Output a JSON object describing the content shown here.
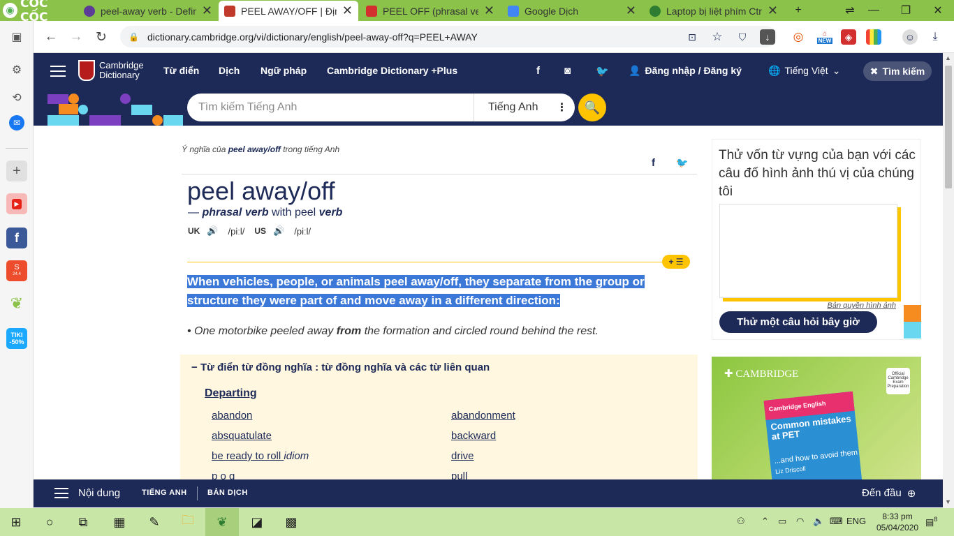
{
  "browser": {
    "brand": "CỐC CỐC",
    "tabs": [
      {
        "title": "peel-away verb - Definit",
        "active": false
      },
      {
        "title": "PEEL AWAY/OFF | Định n",
        "active": true
      },
      {
        "title": "PEEL OFF (phrasal verb)",
        "active": false
      },
      {
        "title": "Google Dịch",
        "active": false
      },
      {
        "title": "Laptop bị liệt phím Ctrl",
        "active": false
      }
    ],
    "new_tab": "+",
    "url": "dictionary.cambridge.org/vi/dictionary/english/peel-away-off?q=PEEL+AWAY",
    "new_badge": "NEW"
  },
  "sidebar_apps": {
    "tiki_label": "TIKI -50%",
    "shopee_label": "24.4"
  },
  "header": {
    "logo_line1": "Cambridge",
    "logo_line2": "Dictionary",
    "nav": [
      "Từ điển",
      "Dịch",
      "Ngữ pháp",
      "Cambridge Dictionary +Plus"
    ],
    "login": "Đăng nhập / Đăng ký",
    "language": "Tiếng Việt",
    "search_toggle": "Tìm kiếm"
  },
  "search": {
    "placeholder": "Tìm kiếm Tiếng Anh",
    "dictionary_lang": "Tiếng Anh"
  },
  "entry": {
    "breadcrumb_prefix": "Ý nghĩa của ",
    "breadcrumb_word": "peel away/off",
    "breadcrumb_suffix": " trong tiếng Anh",
    "headword": "peel away/off",
    "pos_dash": "— ",
    "pos": "phrasal verb",
    "pos_with": " with peel ",
    "pos_base": "verb",
    "uk_label": "UK",
    "uk_ipa": "/piːl/",
    "us_label": "US",
    "us_ipa": "/piːl/",
    "add_list": "+ ☰",
    "definition": "When vehicles, people, or animals peel away/off, they separate from the group or structure they were part of and move away in a different direction:",
    "example_before": "One motorbike peeled away ",
    "example_bold": "from",
    "example_after": " the formation and circled round behind the rest."
  },
  "thesaurus": {
    "title": "Từ điển từ đồng nghĩa : từ đồng nghĩa và các từ liên quan",
    "category": "Departing",
    "items_left": [
      "abandon",
      "absquatulate",
      "be ready to roll",
      "p o g"
    ],
    "items_left_idiom": "idiom",
    "items_right": [
      "abandonment",
      "backward",
      "drive",
      "pull"
    ]
  },
  "quiz": {
    "title": "Thử vốn từ vựng của bạn với các câu đố hình ảnh thú vị của chúng tôi",
    "credit": "Bản quyền hình ảnh",
    "button": "Thử một câu hỏi bây giờ"
  },
  "ad": {
    "brand": "CAMBRIDGE",
    "edition": "Cambridge English",
    "book_title": "Common mistakes at PET",
    "book_sub": "...and how to avoid them",
    "book_author": "Liz Driscoll",
    "badge": "Official Cambridge Exam Preparation"
  },
  "bottom_bar": {
    "contents": "Nội dung",
    "tab1": "TIẾNG ANH",
    "tab2": "BẢN DỊCH",
    "to_top": "Đến đầu"
  },
  "taskbar": {
    "lang": "ENG",
    "time": "8:33 pm",
    "date": "05/04/2020",
    "notifications": "8"
  },
  "colors": {
    "brand_navy": "#1d2a57",
    "accent_yellow": "#fec400",
    "coccoc_green": "#8bc34a",
    "highlight": "#3b78d8"
  }
}
